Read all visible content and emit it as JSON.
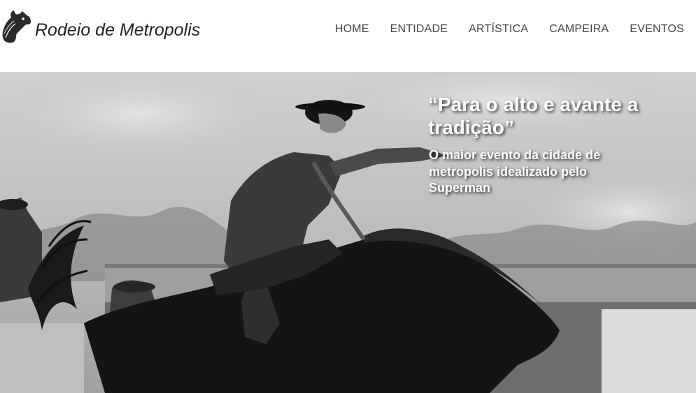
{
  "header": {
    "logo_icon": "horse-head-icon",
    "site_title": "Rodeio de Metropolis"
  },
  "nav": {
    "items": [
      {
        "label": "HOME"
      },
      {
        "label": "ENTIDADE"
      },
      {
        "label": "ARTÍSTICA"
      },
      {
        "label": "CAMPEIRA"
      },
      {
        "label": "EVENTOS"
      }
    ]
  },
  "hero": {
    "image": "bronc-rider-photo",
    "quote": "“Para o alto e avante a tradição”",
    "subtitle": "O maior evento da cidade de metropolis idealizado pelo Superman"
  },
  "colors": {
    "background": "#ffffff",
    "nav_text": "#444444",
    "title_text": "#222222",
    "hero_text": "#ffffff"
  }
}
